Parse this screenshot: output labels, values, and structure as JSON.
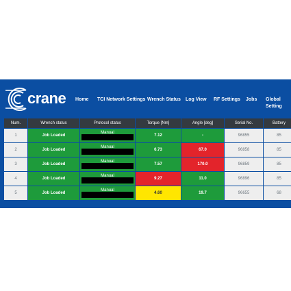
{
  "header": {
    "logo_text": "crane",
    "nav": [
      "Home",
      "TCI Network Settings",
      "Wrench Status",
      "Log View",
      "RF Settings",
      "Jobs",
      "Global Setting"
    ]
  },
  "table": {
    "columns": [
      "Num.",
      "Wrench status",
      "Protocol status",
      "Torque [Nm]",
      "Angle [deg]",
      "Serial No.",
      "Battery"
    ],
    "rows": [
      {
        "num": "1",
        "wrench_status": "Job Loaded",
        "protocol": "Manual",
        "torque": "7.12",
        "angle": "-",
        "serial": "96855",
        "battery": "85"
      },
      {
        "num": "2",
        "wrench_status": "Job Loaded",
        "protocol": "Manual",
        "torque": "6.73",
        "angle": "67.0",
        "serial": "96858",
        "battery": "85"
      },
      {
        "num": "3",
        "wrench_status": "Job Loaded",
        "protocol": "Manual",
        "torque": "7.57",
        "angle": "170.0",
        "serial": "96859",
        "battery": "85"
      },
      {
        "num": "4",
        "wrench_status": "Job Loaded",
        "protocol": "Manual",
        "torque": "9.27",
        "angle": "11.0",
        "serial": "96896",
        "battery": "85"
      },
      {
        "num": "5",
        "wrench_status": "Job Loaded",
        "protocol": "Manual",
        "torque": "4.60",
        "angle": "19.7",
        "serial": "96655",
        "battery": "68"
      }
    ]
  },
  "colors": {
    "header_bg": "#0b4ea2",
    "table_header_bg": "#343a40",
    "ok_green": "#1e9b3b",
    "alert_red": "#e3242b",
    "warn_yellow": "#ffe600",
    "neutral_grey": "#eeeeee"
  }
}
